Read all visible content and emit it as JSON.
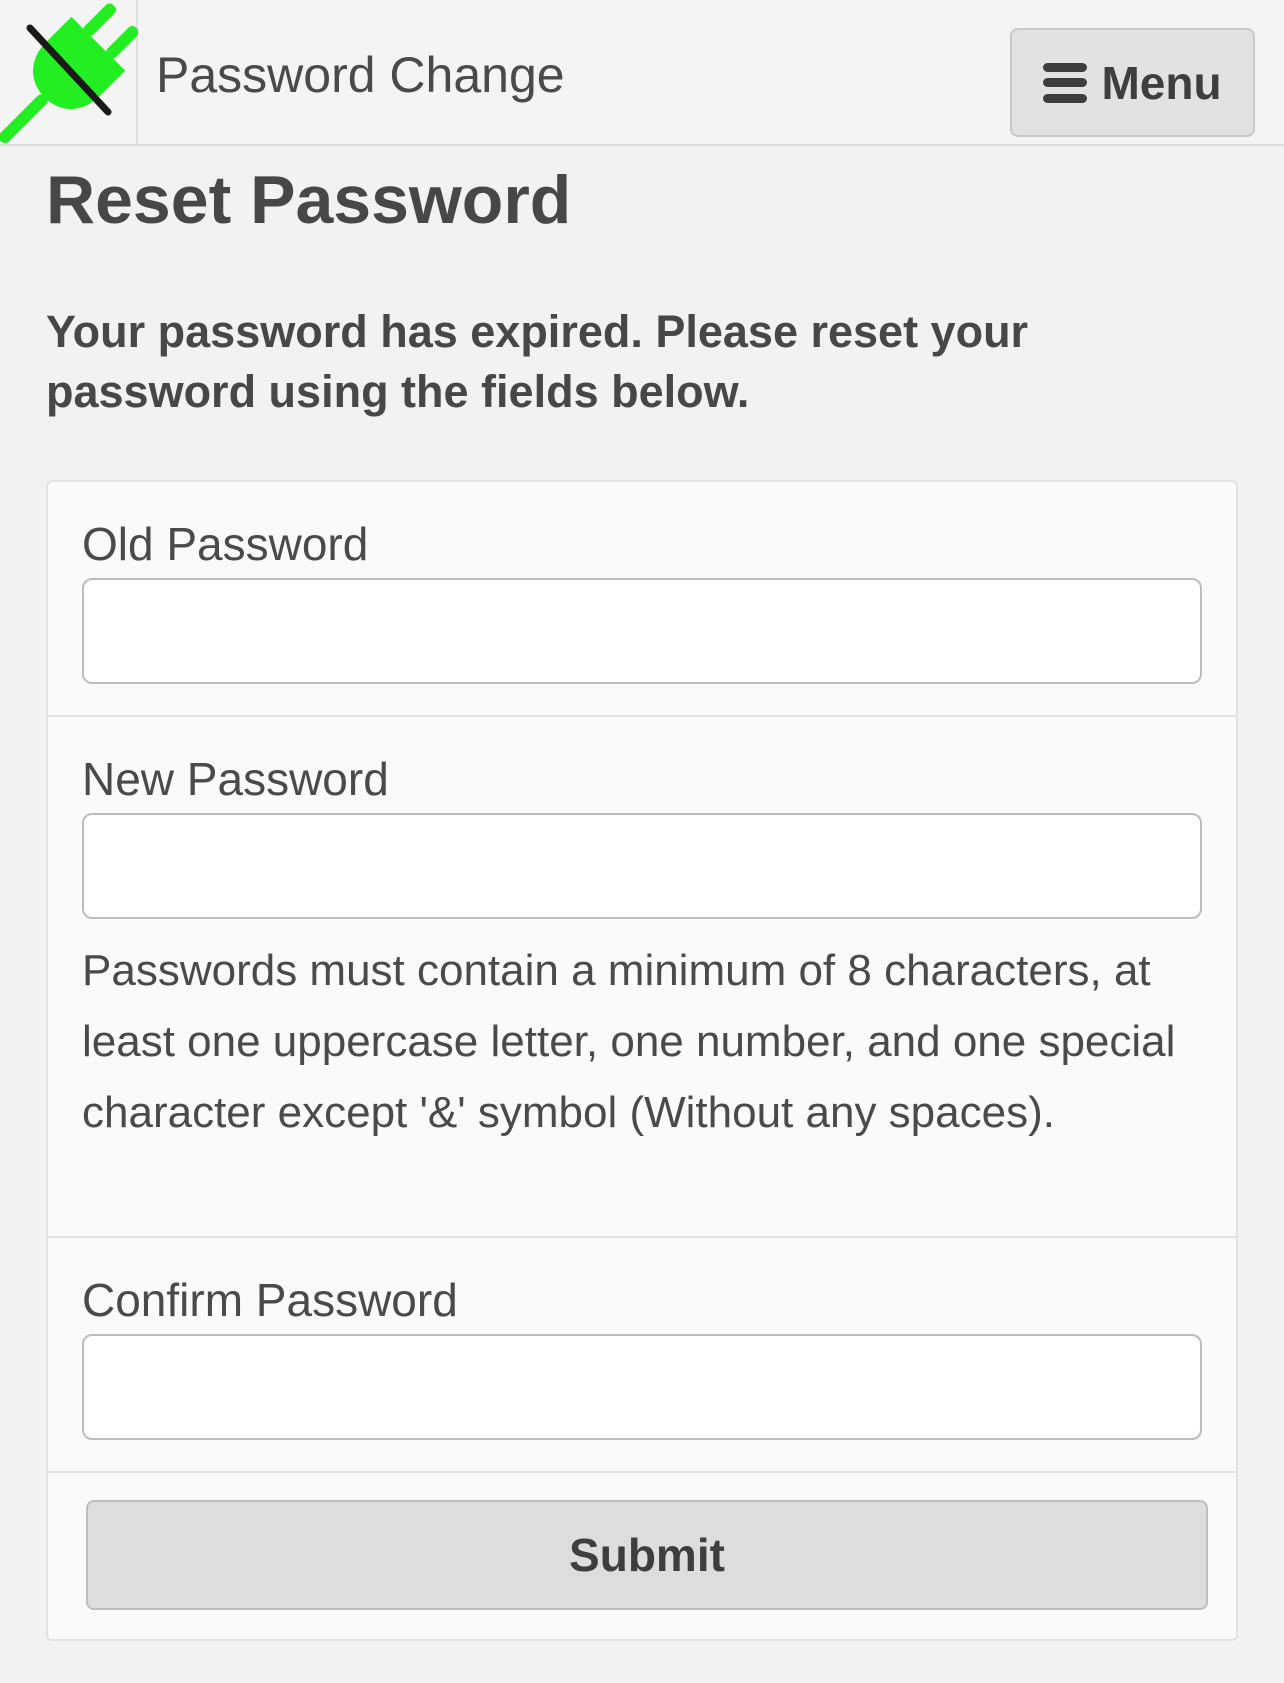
{
  "header": {
    "logo_icon": "unplugged-plug-icon",
    "logo_color": "#22ee22",
    "title": "Password Change",
    "menu_icon": "hamburger-menu-icon",
    "menu_label": "Menu"
  },
  "main": {
    "title": "Reset Password",
    "intro": "Your password has expired. Please reset your password using the fields below."
  },
  "form": {
    "old_password": {
      "label": "Old Password",
      "value": "",
      "placeholder": ""
    },
    "new_password": {
      "label": "New Password",
      "value": "",
      "placeholder": "",
      "hint": "Passwords must contain a minimum of 8 characters, at least one uppercase letter, one number, and one special character except '&' symbol (Without any spaces)."
    },
    "confirm_password": {
      "label": "Confirm Password",
      "value": "",
      "placeholder": ""
    },
    "submit_label": "Submit"
  }
}
